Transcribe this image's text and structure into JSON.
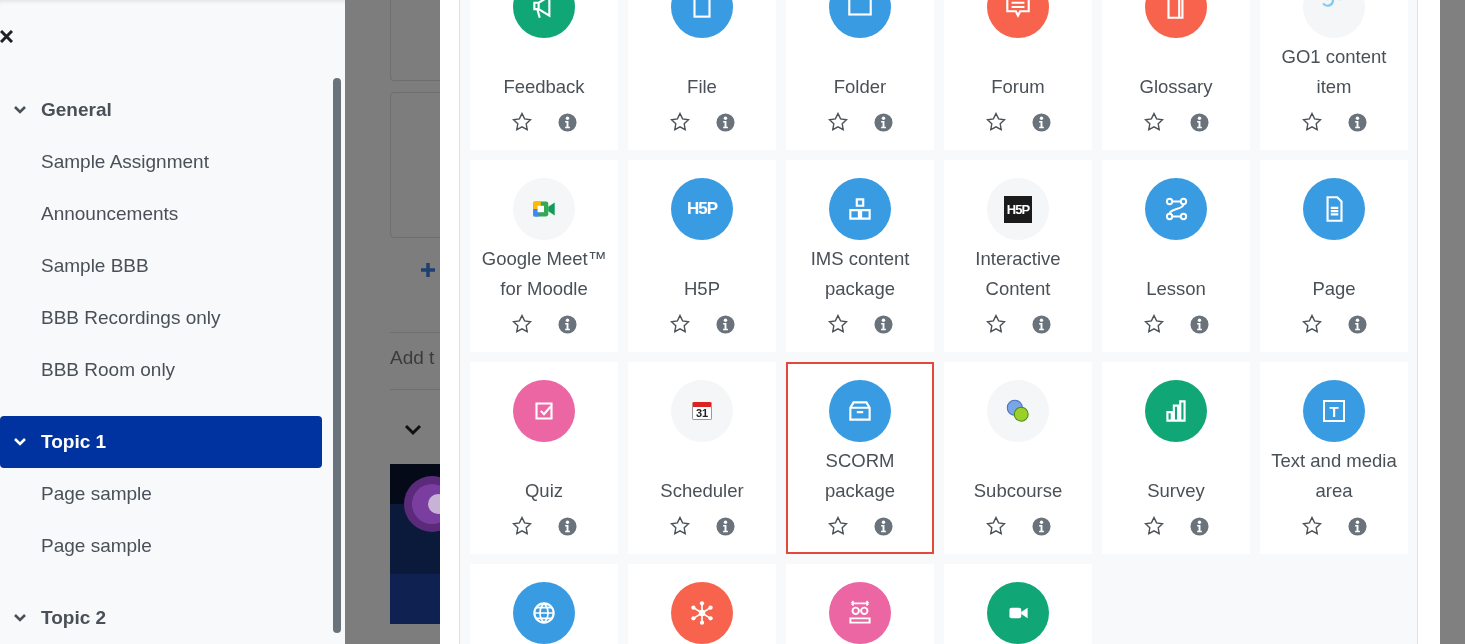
{
  "course_index": {
    "sections": [
      {
        "title": "General",
        "expanded": true,
        "selected": false,
        "items": [
          "Sample Assignment",
          "Announcements",
          "Sample BBB",
          "BBB Recordings only",
          "BBB Room only"
        ]
      },
      {
        "title": "Topic 1",
        "expanded": true,
        "selected": true,
        "items": [
          "Page sample",
          "Page sample"
        ]
      },
      {
        "title": "Topic 2",
        "expanded": true,
        "selected": false
      }
    ]
  },
  "backdrop": {
    "add_text": "Add t"
  },
  "activities": [
    {
      "label": "Feedback",
      "color": "#11a676",
      "starred": false,
      "selected": false
    },
    {
      "label": "File",
      "color": "#399be2",
      "starred": false,
      "selected": false
    },
    {
      "label": "Folder",
      "color": "#399be2",
      "starred": false,
      "selected": false
    },
    {
      "label": "Forum",
      "color": "#f7634d",
      "starred": false,
      "selected": false
    },
    {
      "label": "Glossary",
      "color": "#f7634d",
      "starred": false,
      "selected": false
    },
    {
      "label": "GO1 content item",
      "color": "#f5f6f7",
      "starred": false,
      "selected": false
    },
    {
      "label": "Google Meet™ for Moodle",
      "color": "#f5f6f7",
      "starred": false,
      "selected": false
    },
    {
      "label": "H5P",
      "color": "#399be2",
      "badge": "H5P",
      "starred": false,
      "selected": false
    },
    {
      "label": "IMS content package",
      "color": "#399be2",
      "starred": false,
      "selected": false
    },
    {
      "label": "Interactive Content",
      "color": "#f5f6f7",
      "badge": "H5P",
      "starred": false,
      "selected": false
    },
    {
      "label": "Lesson",
      "color": "#399be2",
      "starred": false,
      "selected": false
    },
    {
      "label": "Page",
      "color": "#399be2",
      "starred": false,
      "selected": false
    },
    {
      "label": "Quiz",
      "color": "#eb66a2",
      "starred": false,
      "selected": false
    },
    {
      "label": "Scheduler",
      "color": "#f5f6f7",
      "badge": "31",
      "starred": false,
      "selected": false
    },
    {
      "label": "SCORM package",
      "color": "#399be2",
      "starred": false,
      "selected": true
    },
    {
      "label": "Subcourse",
      "color": "#f5f6f7",
      "starred": false,
      "selected": false
    },
    {
      "label": "Survey",
      "color": "#11a676",
      "starred": false,
      "selected": false
    },
    {
      "label": "Text and media area",
      "color": "#399be2",
      "badge": "T",
      "starred": false,
      "selected": false
    },
    {
      "color": "#399be2",
      "selected": false
    },
    {
      "color": "#f7634d",
      "selected": false
    },
    {
      "color": "#eb66a2",
      "selected": false
    },
    {
      "color": "#11a676",
      "selected": false
    }
  ]
}
